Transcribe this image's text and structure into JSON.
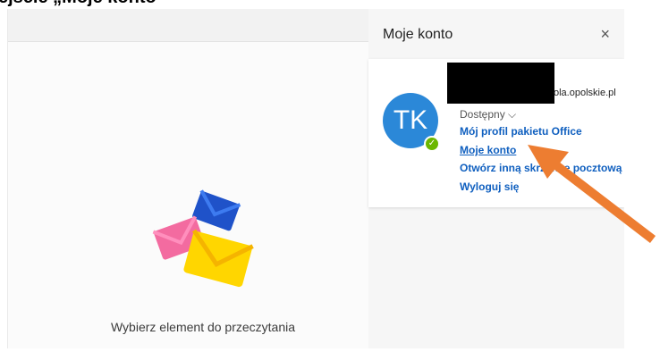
{
  "doc_heading": "ejście „Moje konto\"",
  "reading_pane": {
    "empty_text": "Wybierz element do przeczytania"
  },
  "account_panel": {
    "title": "Moje konto",
    "close_symbol": "×",
    "email_suffix": "ola.opolskie.pl",
    "avatar_initials": "TK",
    "presence_check": "✓",
    "status": "Dostępny ⌵",
    "links": {
      "profile": "Mój profil pakietu Office",
      "my_account": "Moje konto",
      "other_mailbox": "Otwórz inną skrzynkę pocztową",
      "sign_out": "Wyloguj się"
    }
  },
  "colors": {
    "link": "#0f5fbf",
    "avatar": "#2b88d8",
    "presence": "#6bb700",
    "arrow": "#ed7d31"
  }
}
